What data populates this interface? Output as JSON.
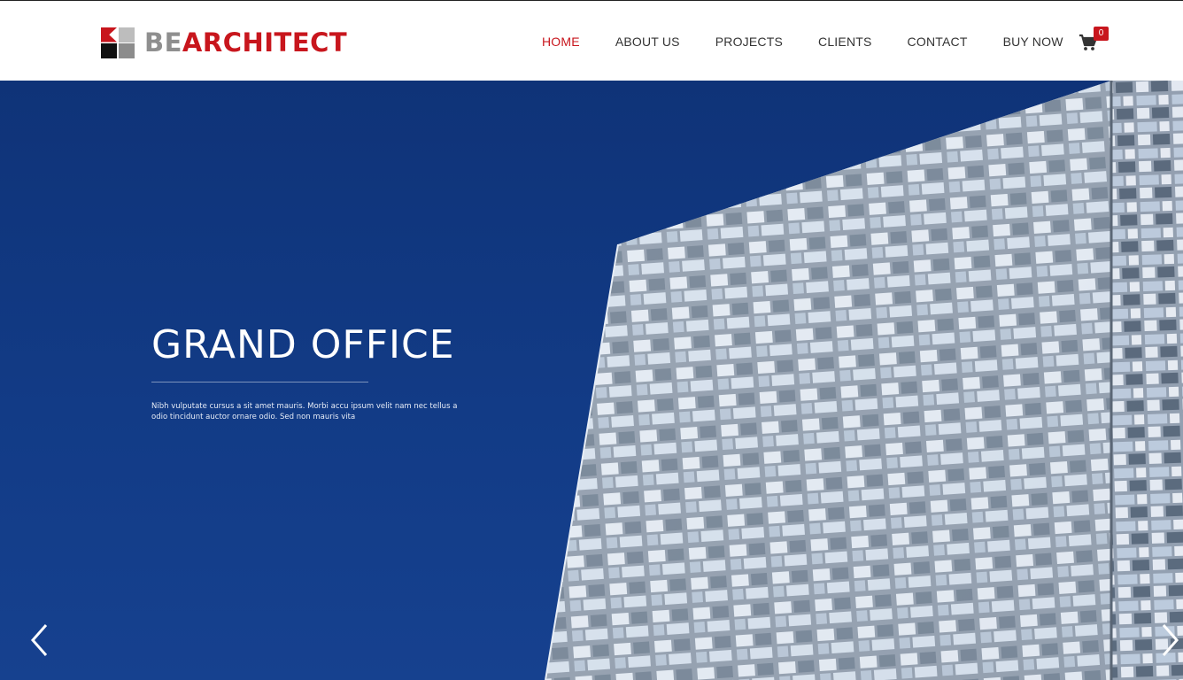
{
  "brand": {
    "logo_part1": "BE",
    "logo_part2": "ARCHITECT",
    "colors": {
      "accent": "#c8161d",
      "grey": "#8f8f8f",
      "hero_blue": "#123b86"
    }
  },
  "nav": {
    "items": [
      {
        "label": "HOME",
        "active": true
      },
      {
        "label": "ABOUT US",
        "active": false
      },
      {
        "label": "PROJECTS",
        "active": false
      },
      {
        "label": "CLIENTS",
        "active": false
      },
      {
        "label": "CONTACT",
        "active": false
      },
      {
        "label": "BUY NOW",
        "active": false
      }
    ]
  },
  "cart": {
    "icon": "cart-icon",
    "count": "0"
  },
  "hero": {
    "title": "GRAND OFFICE",
    "text": "Nibh vulputate cursus a sit amet mauris. Morbi accu ipsum velit nam nec tellus a odio tincidunt auctor ornare odio. Sed non mauris vita",
    "prev_icon": "chevron-left-icon",
    "next_icon": "chevron-right-icon"
  }
}
